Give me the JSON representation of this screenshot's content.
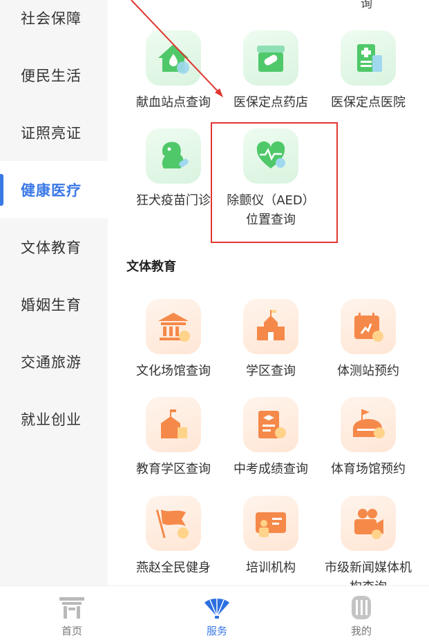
{
  "sidebar": {
    "items": [
      {
        "label": "社会保障"
      },
      {
        "label": "便民生活"
      },
      {
        "label": "证照亮证"
      },
      {
        "label": "健康医疗"
      },
      {
        "label": "文体教育"
      },
      {
        "label": "婚姻生育"
      },
      {
        "label": "交通旅游"
      },
      {
        "label": "就业创业"
      }
    ],
    "active_index": 3
  },
  "main": {
    "top_cut_text": "询",
    "health": {
      "tiles": [
        {
          "label": "献血站点查询",
          "icon": "blood-station-icon"
        },
        {
          "label": "医保定点药店",
          "icon": "pharmacy-icon"
        },
        {
          "label": "医保定点医院",
          "icon": "hospital-icon"
        },
        {
          "label": "狂犬疫苗门诊",
          "icon": "dog-vaccine-icon"
        },
        {
          "label": "除颤仪（AED）位置查询",
          "icon": "aed-heart-icon"
        }
      ]
    },
    "culture": {
      "title": "文体教育",
      "tiles": [
        {
          "label": "文化场馆查询",
          "icon": "museum-icon"
        },
        {
          "label": "学区查询",
          "icon": "school-icon"
        },
        {
          "label": "体测站预约",
          "icon": "fitness-test-icon"
        },
        {
          "label": "教育学区查询",
          "icon": "education-district-icon"
        },
        {
          "label": "中考成绩查询",
          "icon": "exam-score-icon"
        },
        {
          "label": "体育场馆预约",
          "icon": "stadium-icon"
        },
        {
          "label": "燕赵全民健身",
          "icon": "flag-icon"
        },
        {
          "label": "培训机构",
          "icon": "training-icon"
        },
        {
          "label": "市级新闻媒体机构查询",
          "icon": "media-camera-icon"
        }
      ]
    }
  },
  "tabbar": {
    "tabs": [
      {
        "label": "首页",
        "icon": "home-gate-icon"
      },
      {
        "label": "服务",
        "icon": "service-fan-icon"
      },
      {
        "label": "我的",
        "icon": "profile-icon"
      }
    ],
    "active_index": 1
  },
  "colors": {
    "accent": "#3a78e6",
    "green": "#4fc86a",
    "orange": "#f5894a",
    "highlight": "#e0362f"
  }
}
